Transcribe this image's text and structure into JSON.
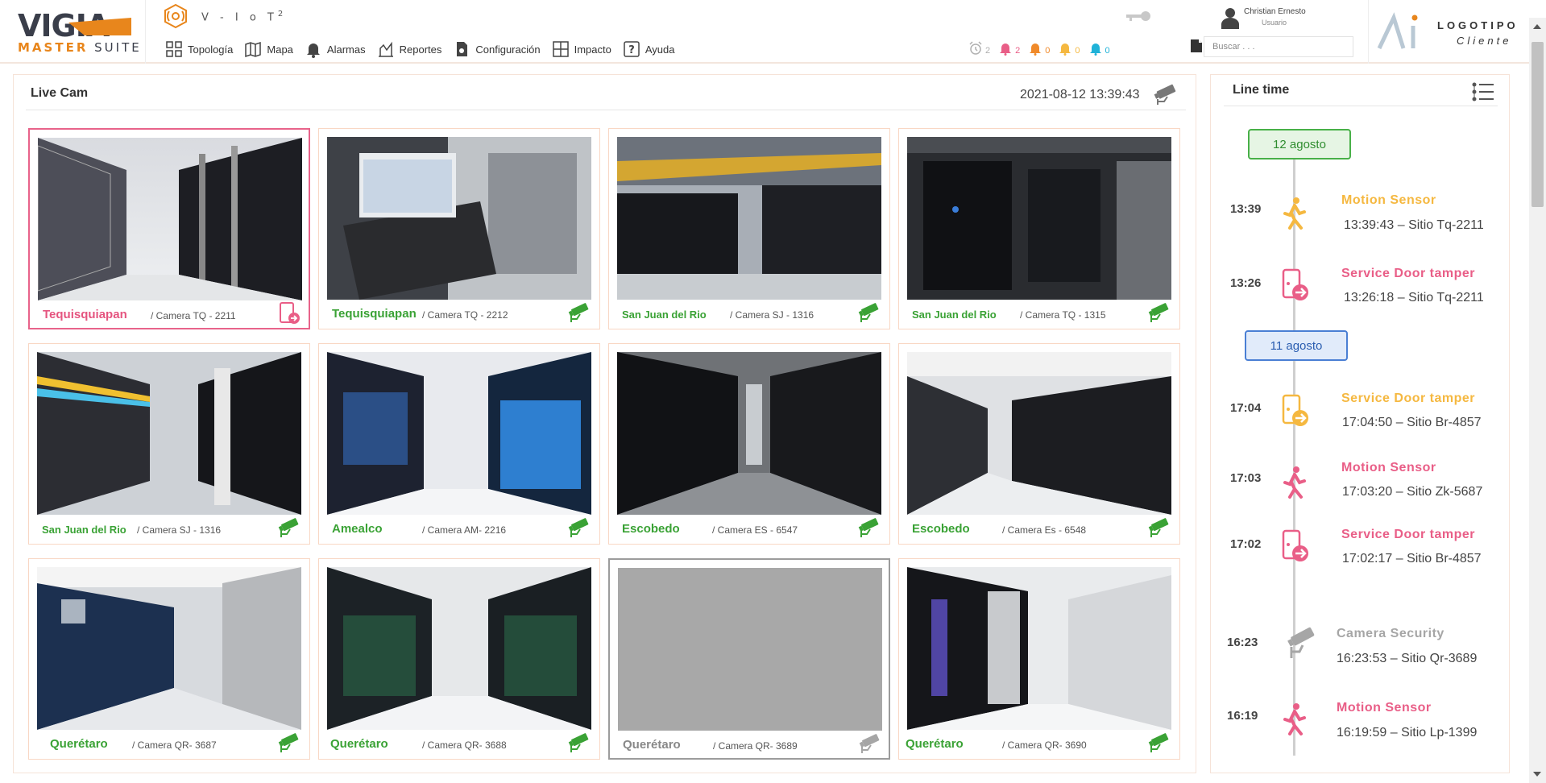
{
  "brand": {
    "name": "VIGIA",
    "sub_left": "MASTER",
    "sub_right": "SUITE"
  },
  "app": {
    "title": "V - I o T",
    "superscript": "2"
  },
  "nav": [
    {
      "label": "Topología",
      "icon": "topology-icon"
    },
    {
      "label": "Mapa",
      "icon": "map-icon"
    },
    {
      "label": "Alarmas",
      "icon": "bell-icon"
    },
    {
      "label": "Reportes",
      "icon": "reports-icon"
    },
    {
      "label": "Configuración",
      "icon": "config-icon"
    },
    {
      "label": "Impacto",
      "icon": "impact-icon"
    },
    {
      "label": "Ayuda",
      "icon": "help-icon"
    }
  ],
  "alerts": [
    {
      "icon": "alarm-clock-icon",
      "count": "2",
      "color": "#b0b0b0"
    },
    {
      "icon": "bell-pink-icon",
      "count": "2",
      "color": "#e95e87"
    },
    {
      "icon": "bell-orange-icon",
      "count": "0",
      "color": "#f08a2a"
    },
    {
      "icon": "bell-yellow-icon",
      "count": "0",
      "color": "#f5b840"
    },
    {
      "icon": "bell-cyan-icon",
      "count": "0",
      "color": "#1fb2d8"
    }
  ],
  "user": {
    "name": "Christian Ernesto",
    "role": "Usuario"
  },
  "search": {
    "placeholder": "Buscar . . ."
  },
  "client": {
    "line1": "LOGOTIPO",
    "line2": "Cliente"
  },
  "live": {
    "title": "Live Cam",
    "datetime": "2021-08-12 13:39:43"
  },
  "cameras": [
    {
      "place": "Tequisquiapan",
      "camera": "/ Camera TQ -  2211",
      "status": "alert"
    },
    {
      "place": "Tequisquiapan",
      "camera": "/ Camera TQ -  2212",
      "status": "ok"
    },
    {
      "place": "San Juan del Rio",
      "camera": "/ Camera SJ -  1316",
      "status": "ok"
    },
    {
      "place": "San Juan del Rio",
      "camera": "/ Camera TQ -  1315",
      "status": "ok"
    },
    {
      "place": "San Juan del Rio",
      "camera": "/ Camera SJ -  1316",
      "status": "ok"
    },
    {
      "place": "Amealco",
      "camera": "/ Camera AM-  2216",
      "status": "ok"
    },
    {
      "place": "Escobedo",
      "camera": "/ Camera ES -  6547",
      "status": "ok"
    },
    {
      "place": "Escobedo",
      "camera": "/ Camera Es -  6548",
      "status": "ok"
    },
    {
      "place": "Querétaro",
      "camera": "/ Camera QR-  3687",
      "status": "ok"
    },
    {
      "place": "Querétaro",
      "camera": "/ Camera QR-  3688",
      "status": "ok"
    },
    {
      "place": "Querétaro",
      "camera": "/ Camera QR-  3689",
      "status": "offline"
    },
    {
      "place": "Querétaro",
      "camera": "/ Camera QR-  3690",
      "status": "ok"
    }
  ],
  "timeline": {
    "title": "Line time",
    "dates": [
      "12 agosto",
      "11 agosto"
    ],
    "events": [
      {
        "time": "13:39",
        "title": "Motion Sensor",
        "desc": "13:39:43 – Sitio Tq-2211",
        "icon": "motion-sensor-icon",
        "color": "#f5b840"
      },
      {
        "time": "13:26",
        "title": "Service Door tamper",
        "desc": "13:26:18 – Sitio Tq-2211",
        "icon": "door-tamper-icon",
        "color": "#e95e87"
      },
      {
        "time": "17:04",
        "title": "Service Door tamper",
        "desc": "17:04:50 – Sitio Br-4857",
        "icon": "door-tamper-icon",
        "color": "#f5b840"
      },
      {
        "time": "17:03",
        "title": "Motion Sensor",
        "desc": "17:03:20 – Sitio Zk-5687",
        "icon": "motion-sensor-icon",
        "color": "#e95e87"
      },
      {
        "time": "17:02",
        "title": "Service Door tamper",
        "desc": "17:02:17 – Sitio Br-4857",
        "icon": "door-tamper-icon",
        "color": "#e95e87"
      },
      {
        "time": "16:23",
        "title": "Camera Security",
        "desc": "16:23:53 – Sitio Qr-3689",
        "icon": "security-camera-icon",
        "color": "#a6a6a6"
      },
      {
        "time": "16:19",
        "title": "Motion Sensor",
        "desc": "16:19:59 – Sitio Lp-1399",
        "icon": "motion-sensor-icon",
        "color": "#e95e87"
      }
    ]
  },
  "colors": {
    "accent": "#e8861c",
    "ok": "#3aa235",
    "alert": "#e95e87",
    "warning": "#f5b840"
  }
}
